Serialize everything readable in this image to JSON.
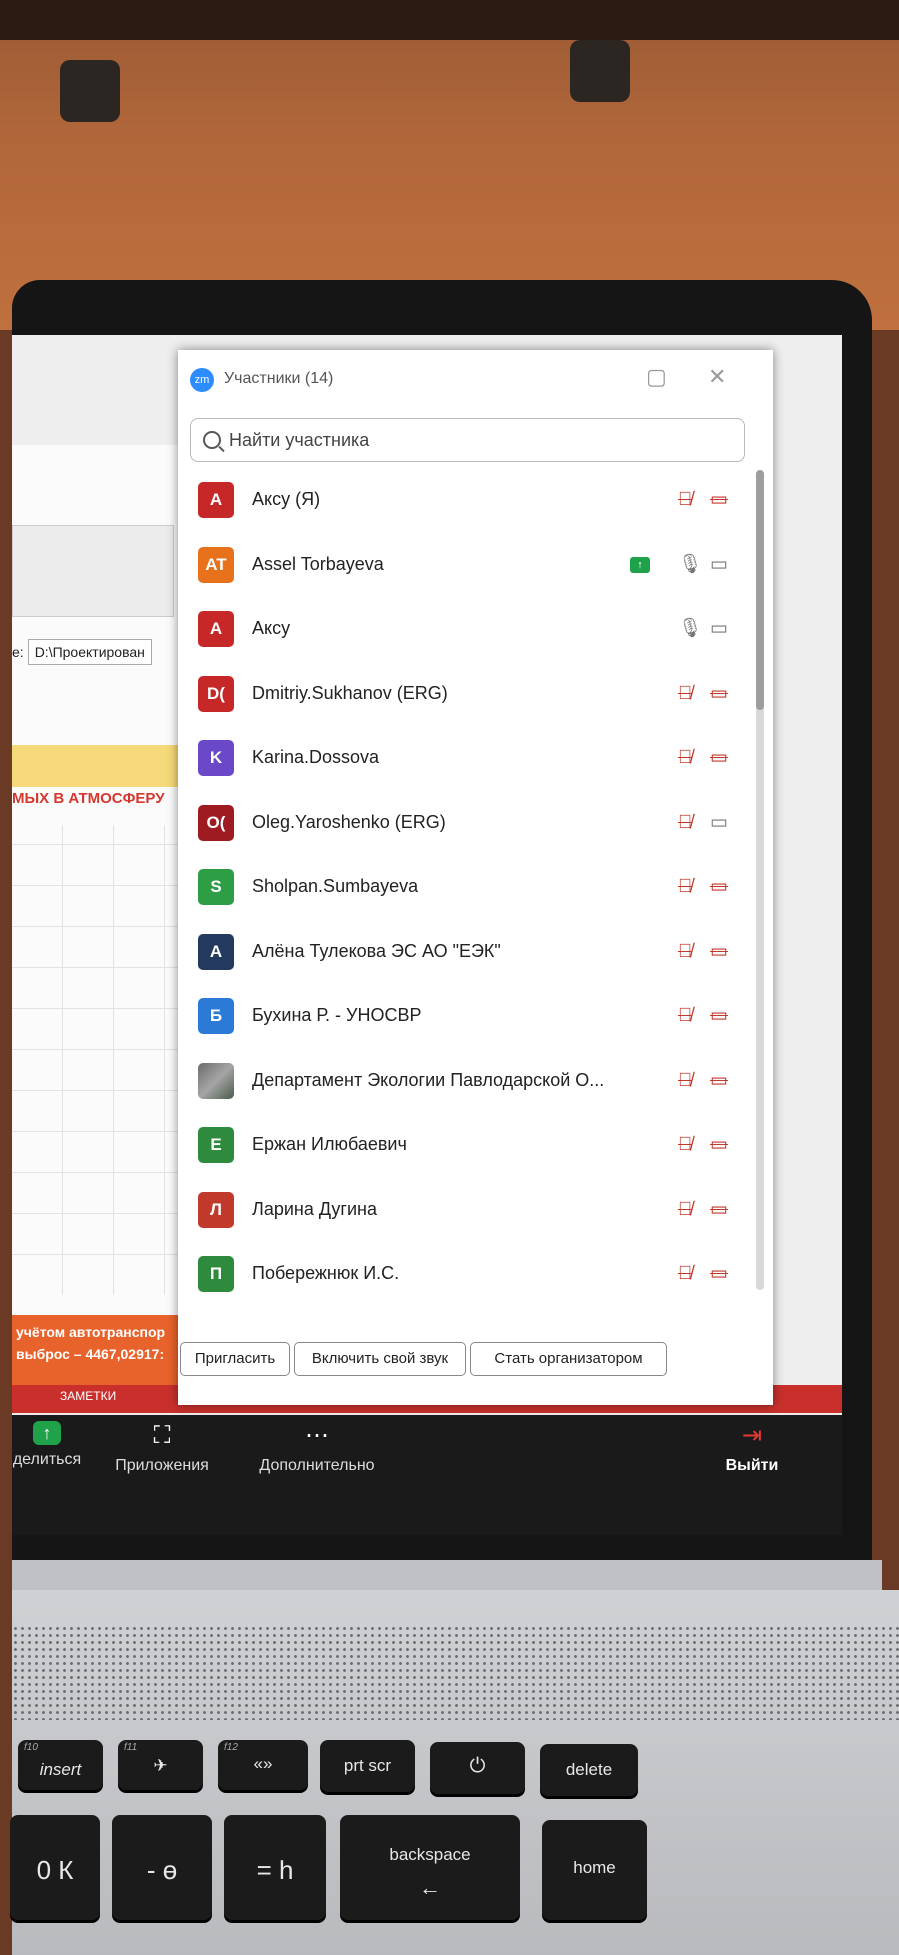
{
  "participants_panel": {
    "logo": "zm",
    "title": "Участники (14)",
    "search_placeholder": "Найти участника",
    "participants": [
      {
        "initials": "А",
        "name": "Аксу (Я)",
        "color": "#c62828",
        "mic": "muted",
        "video": "off"
      },
      {
        "initials": "AT",
        "name": "Assel Torbayeva",
        "color": "#e8711c",
        "mic": "on",
        "video": "on",
        "sharing": true
      },
      {
        "initials": "А",
        "name": "Аксу",
        "color": "#c62828",
        "mic": "on",
        "video": "on"
      },
      {
        "initials": "D(",
        "name": "Dmitriy.Sukhanov (ERG)",
        "color": "#c62828",
        "mic": "muted",
        "video": "off"
      },
      {
        "initials": "K",
        "name": "Karina.Dossova",
        "color": "#6a48c8",
        "mic": "muted",
        "video": "off"
      },
      {
        "initials": "O(",
        "name": "Oleg.Yaroshenko (ERG)",
        "color": "#9e1b22",
        "mic": "muted",
        "video": "on"
      },
      {
        "initials": "S",
        "name": "Sholpan.Sumbayeva",
        "color": "#2e9e46",
        "mic": "muted",
        "video": "off"
      },
      {
        "initials": "А",
        "name": "Алёна Тулекова ЭС АО \"ЕЭК\"",
        "color": "#233a5e",
        "mic": "muted",
        "video": "off"
      },
      {
        "initials": "Б",
        "name": "Бухина Р. - УНОСВР",
        "color": "#2b7bd6",
        "mic": "muted",
        "video": "off"
      },
      {
        "initials": "",
        "name": "Департамент Экологии Павлодарской О...",
        "color": "#777777",
        "mic": "muted",
        "video": "off",
        "photo": true
      },
      {
        "initials": "Е",
        "name": "Ержан Илюбаевич",
        "color": "#2e8b3e",
        "mic": "muted",
        "video": "off"
      },
      {
        "initials": "Л",
        "name": "Ларина Дугина",
        "color": "#c0392b",
        "mic": "muted",
        "video": "off"
      },
      {
        "initials": "П",
        "name": "Побережнюк И.С.",
        "color": "#2e8b3e",
        "mic": "muted",
        "video": "off"
      }
    ],
    "buttons": {
      "invite": "Пригласить",
      "unmute": "Включить свой звук",
      "make_host": "Стать организатором"
    }
  },
  "toolbar": {
    "share": "делиться",
    "apps": "Приложения",
    "more": "Дополнительно",
    "leave": "Выйти"
  },
  "background_doc": {
    "path_label": "e:",
    "path_value": "D:\\Проектирован",
    "red_heading": "МЫХ В АТМОСФЕРУ",
    "orange_line1": "учётом автотранспор",
    "orange_line2": "выброс – 4467,02917:",
    "notes_label": "ЗАМЕТКИ"
  },
  "keyboard": {
    "insert": "insert",
    "prt_scr": "prt scr",
    "delete": "delete",
    "backspace": "backspace",
    "home": "home",
    "fn10": "f10",
    "fn11": "f11",
    "fn12": "f12"
  }
}
